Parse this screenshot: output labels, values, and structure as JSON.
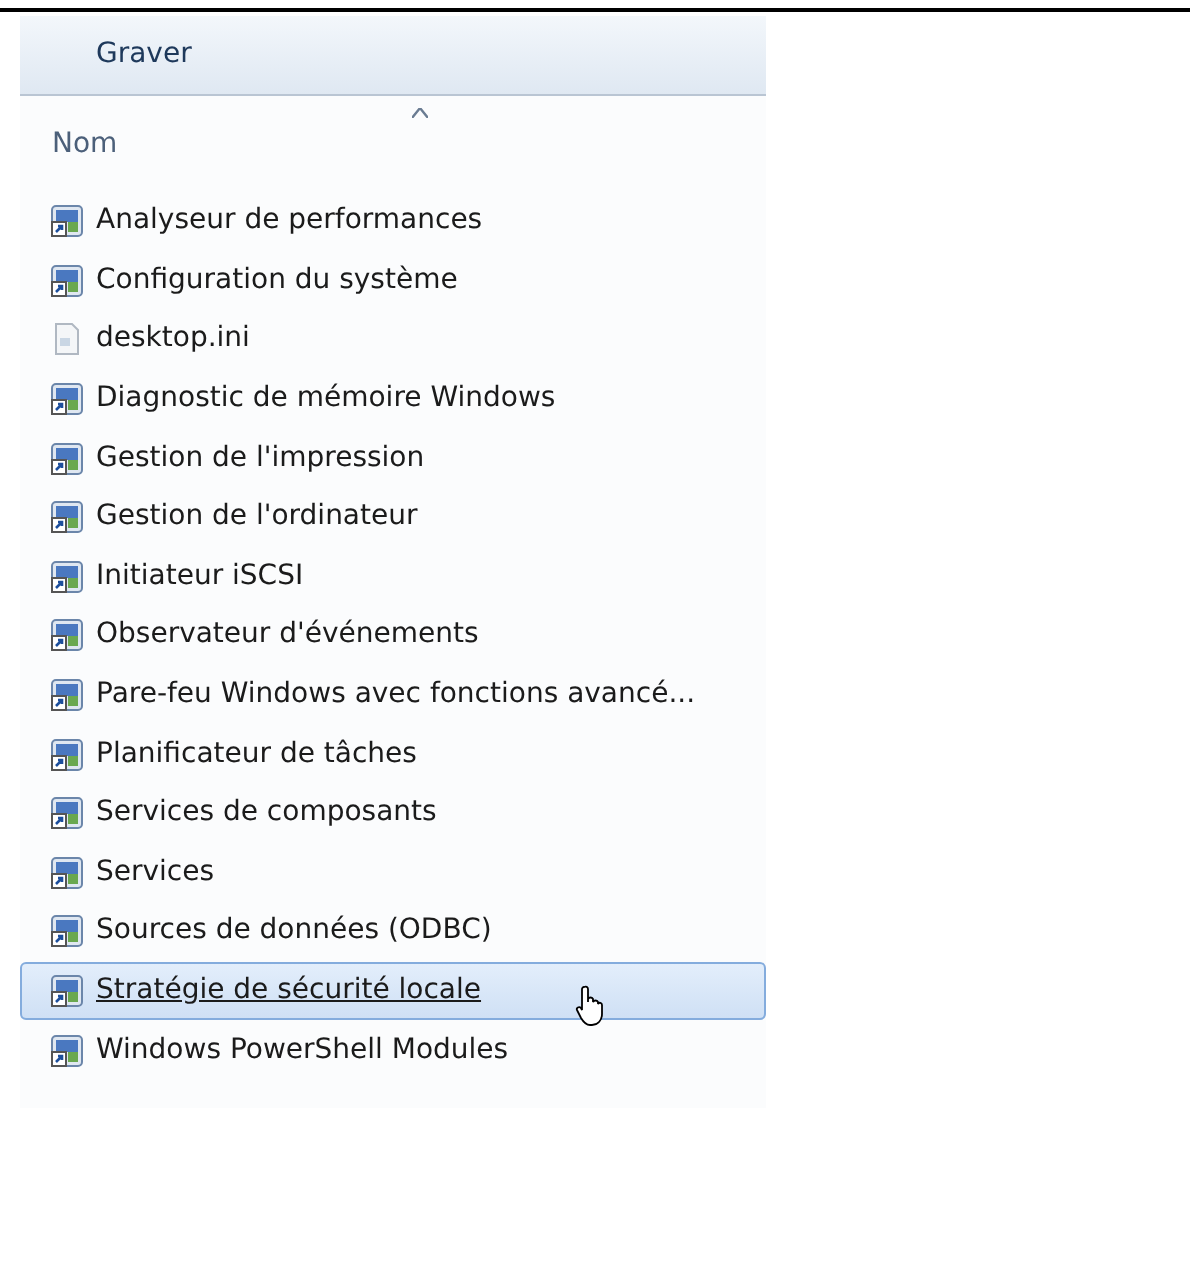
{
  "toolbar": {
    "button": "Graver"
  },
  "column_header": {
    "label": "Nom",
    "sorted": true
  },
  "files": [
    {
      "name": "Analyseur de performances",
      "kind": "shortcut",
      "selected": false
    },
    {
      "name": "Configuration du système",
      "kind": "shortcut",
      "selected": false
    },
    {
      "name": "desktop.ini",
      "kind": "file",
      "selected": false
    },
    {
      "name": "Diagnostic de mémoire Windows",
      "kind": "shortcut",
      "selected": false
    },
    {
      "name": "Gestion de l'impression",
      "kind": "shortcut",
      "selected": false
    },
    {
      "name": "Gestion de l'ordinateur",
      "kind": "shortcut",
      "selected": false
    },
    {
      "name": "Initiateur iSCSI",
      "kind": "shortcut",
      "selected": false
    },
    {
      "name": "Observateur d'événements",
      "kind": "shortcut",
      "selected": false
    },
    {
      "name": "Pare-feu Windows avec fonctions avancé...",
      "kind": "shortcut",
      "selected": false
    },
    {
      "name": "Planificateur de tâches",
      "kind": "shortcut",
      "selected": false
    },
    {
      "name": "Services de composants",
      "kind": "shortcut",
      "selected": false
    },
    {
      "name": "Services",
      "kind": "shortcut",
      "selected": false
    },
    {
      "name": "Sources de données (ODBC)",
      "kind": "shortcut",
      "selected": false
    },
    {
      "name": "Stratégie de sécurité locale",
      "kind": "shortcut",
      "selected": true
    },
    {
      "name": "Windows PowerShell Modules",
      "kind": "shortcut",
      "selected": false
    }
  ]
}
